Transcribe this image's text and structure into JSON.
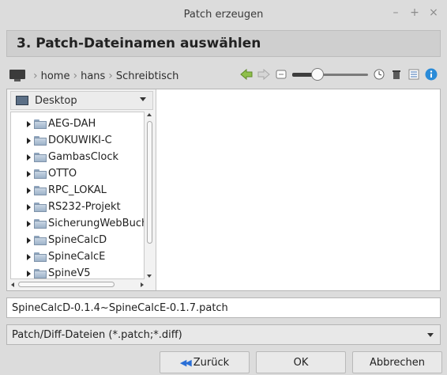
{
  "window": {
    "title": "Patch erzeugen",
    "controls": {
      "minimize": "–",
      "maximize": "+",
      "close": "×"
    }
  },
  "step_header": "3. Patch-Dateinamen auswählen",
  "path": {
    "crumbs": [
      "home",
      "hans",
      "Schreibtisch"
    ],
    "icons": [
      "computer-icon",
      "back-icon",
      "forward-icon",
      "view-icon",
      "zoom-slider",
      "recent-icon",
      "trash-icon",
      "details-icon",
      "info-icon"
    ],
    "zoom_level": 0.3
  },
  "places": {
    "selected": "Desktop"
  },
  "tree": {
    "items": [
      "AEG-DAH",
      "DOKUWIKI-C",
      "GambasClock",
      "OTTO",
      "RPC_LOKAL",
      "RS232-Projekt",
      "SicherungWebBuch",
      "SpineCalcD",
      "SpineCalcE",
      "SpineV5"
    ]
  },
  "filename": "SpineCalcD-0.1.4~SpineCalcE-0.1.7.patch",
  "filter": "Patch/Diff-Dateien (*.patch;*.diff)",
  "buttons": {
    "back": "Zurück",
    "ok": "OK",
    "cancel": "Abbrechen"
  },
  "colors": {
    "accent": "#2a6fd6",
    "info": "#2a8bd8",
    "back_arrow": "#8fc04a"
  }
}
